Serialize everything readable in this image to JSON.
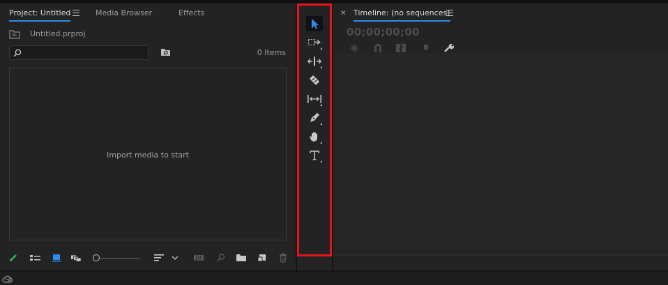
{
  "project": {
    "tabs": [
      {
        "label": "Project: Untitled",
        "active": true
      },
      {
        "label": "Media Browser",
        "active": false
      },
      {
        "label": "Effects",
        "active": false
      }
    ],
    "file_name": "Untitled.prproj",
    "search": {
      "placeholder": "",
      "value": ""
    },
    "items_count": "0 Items",
    "empty_message": "Import media to start",
    "bottom_tools": [
      "pencil-icon",
      "list-view-icon",
      "icon-view-icon",
      "freeform-view-icon",
      "zoom-slider",
      "sort-icon",
      "automate-to-sequence-icon",
      "find-icon",
      "new-bin-icon",
      "new-item-icon",
      "trash-icon"
    ]
  },
  "tools": {
    "items": [
      {
        "icon": "selection-tool-icon",
        "active": true
      },
      {
        "icon": "track-select-tool-icon",
        "active": false
      },
      {
        "icon": "ripple-edit-tool-icon",
        "active": false
      },
      {
        "icon": "razor-tool-icon",
        "active": false
      },
      {
        "icon": "slip-tool-icon",
        "active": false
      },
      {
        "icon": "pen-tool-icon",
        "active": false
      },
      {
        "icon": "hand-tool-icon",
        "active": false
      },
      {
        "icon": "type-tool-icon",
        "active": false
      }
    ],
    "highlight_color": "#e8141b"
  },
  "timeline": {
    "close": "×",
    "title": "Timeline: (no sequences)",
    "timecode": "00;00;00;00",
    "tools": [
      "nest-icon",
      "snap-icon",
      "linked-selection-icon",
      "add-marker-icon",
      "settings-wrench-icon"
    ]
  },
  "colors": {
    "accent": "#2d8ceb",
    "panel_bg": "#232323"
  }
}
